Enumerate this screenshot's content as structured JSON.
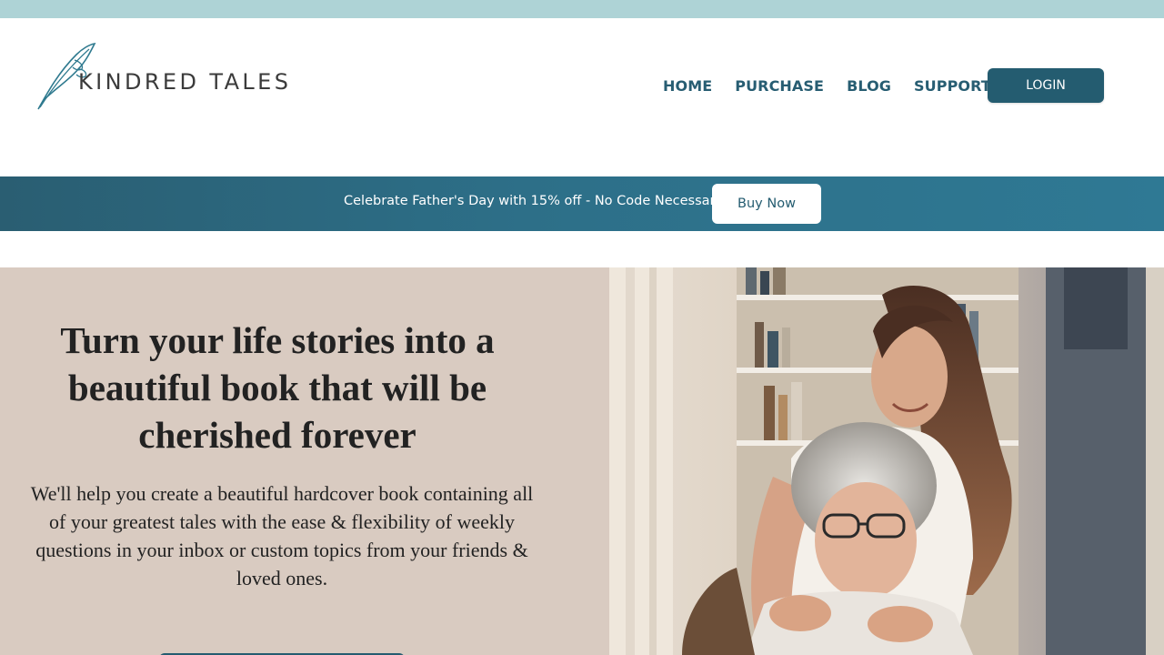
{
  "brand": {
    "name": "KINDRED  TALES",
    "logo_icon": "quill-feather-icon"
  },
  "nav": {
    "items": [
      {
        "label": "HOME"
      },
      {
        "label": "PURCHASE"
      },
      {
        "label": "BLOG"
      },
      {
        "label": "SUPPORT"
      }
    ],
    "login_label": "LOGIN"
  },
  "promo": {
    "text": "Celebrate Father's Day with 15% off - No Code Necessary",
    "button_label": "Buy Now"
  },
  "hero": {
    "title": "Turn your life stories into a beautiful book that will be cherished forever",
    "description": "We'll help you create a beautiful hardcover book containing all of your greatest tales with the ease & flexibility of weekly questions in your inbox or custom topics from your friends & loved ones.",
    "image_subject": "young woman hugging her grandmother from behind in a room with bookshelves"
  },
  "colors": {
    "top_strip": "#aed3d6",
    "brand_teal": "#245c70",
    "nav_text": "#275d72",
    "hero_bg": "#d9cbc1"
  }
}
